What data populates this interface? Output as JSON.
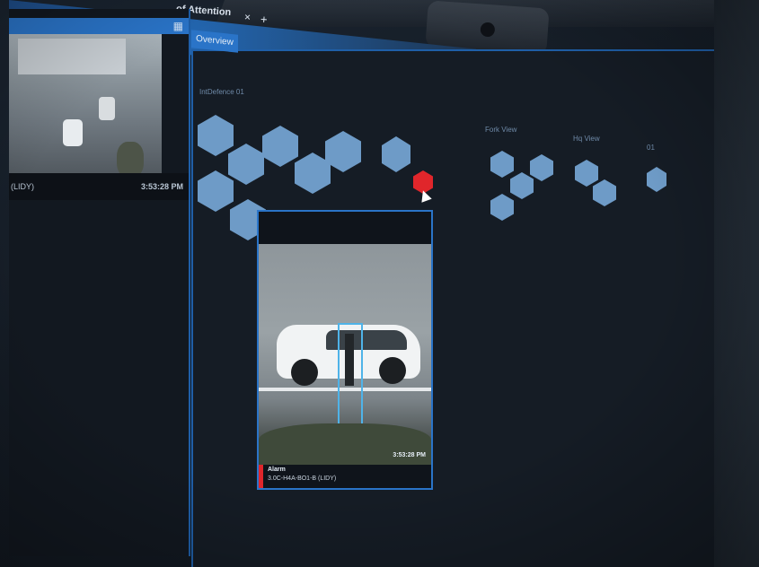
{
  "tabs": {
    "active_title": "of Attention",
    "close_glyph": "×",
    "add_glyph": "+",
    "overview_label": "Overview"
  },
  "left_panel": {
    "header_icon": "grid-icon",
    "camera_name": "(LIDY)",
    "camera_time": "3:53:28 PM"
  },
  "group_labels": [
    "IntDefence 01",
    "Fork View",
    "Hq View",
    "01"
  ],
  "alarm": {
    "type": "Alarm",
    "camera": "3.0C-H4A-BO1-B (LIDY)",
    "time": "3:53:28 PM"
  },
  "colors": {
    "accent": "#2a74c8",
    "hex_normal": "#6e9bc7",
    "hex_alarm": "#e0262b",
    "background": "#151c25"
  }
}
